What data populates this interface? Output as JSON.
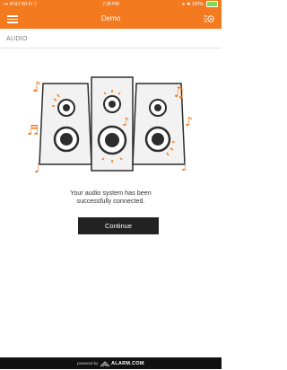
{
  "status_bar": {
    "carrier": "AT&T Wi-Fi",
    "time": "7:38 PM",
    "battery": "100%"
  },
  "nav": {
    "title": "Demo"
  },
  "section": {
    "label": "AUDIO"
  },
  "message": {
    "line1": "Your audio system has been",
    "line2": "successfully connected."
  },
  "buttons": {
    "continue": "Continue"
  },
  "footer": {
    "powered_by": "powered by",
    "brand": "ALARM.COM"
  },
  "colors": {
    "accent": "#f47a20",
    "button": "#222222",
    "footer": "#111111"
  }
}
